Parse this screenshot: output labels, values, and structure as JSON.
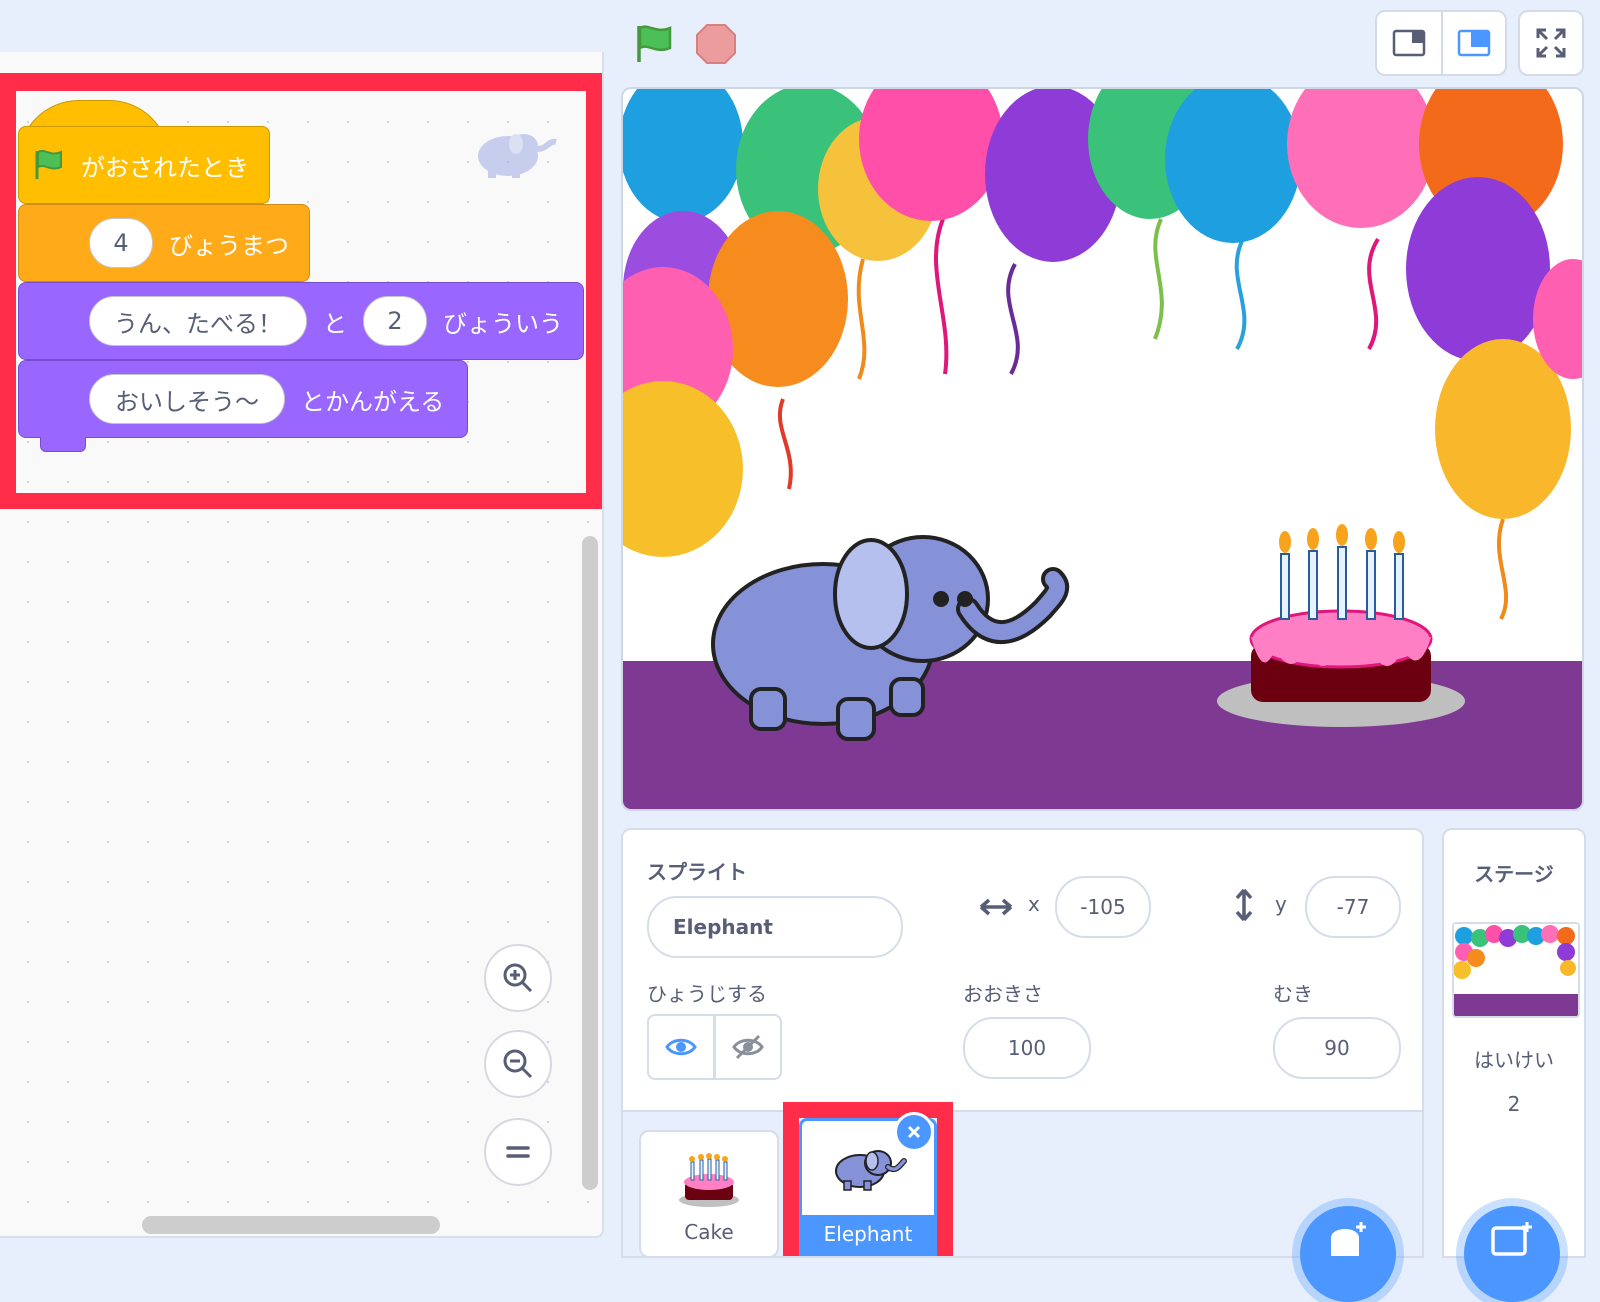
{
  "code": {
    "hat_label": "がおされたとき",
    "wait_value": "4",
    "wait_label": "びょうまつ",
    "say_text": "うん、たべる！",
    "say_connector": "と",
    "say_seconds": "2",
    "say_label": "びょういう",
    "think_text": "おいしそう〜",
    "think_label": "とかんがえる"
  },
  "icons": {
    "flag": "green-flag-icon",
    "stop": "stop-icon",
    "zoom_in": "zoom-in-icon",
    "zoom_out": "zoom-out-icon",
    "zoom_reset": "zoom-reset-icon",
    "show": "eye-icon",
    "hide": "eye-slash-icon"
  },
  "sprite_info": {
    "title": "スプライト",
    "name": "Elephant",
    "x_label": "x",
    "x_value": "-105",
    "y_label": "y",
    "y_value": "-77",
    "show_label": "ひょうじする",
    "size_label": "おおきさ",
    "size_value": "100",
    "direction_label": "むき",
    "direction_value": "90"
  },
  "sprites": [
    {
      "name": "Cake"
    },
    {
      "name": "Elephant",
      "selected": true
    }
  ],
  "stage_panel": {
    "title": "ステージ",
    "backdrops_label": "はいけい",
    "backdrops_count": "2"
  },
  "colors": {
    "events": "#ffbf00",
    "control": "#ffab19",
    "looks": "#9966ff",
    "highlight": "#ff2d4a",
    "accent": "#4c97ff"
  }
}
